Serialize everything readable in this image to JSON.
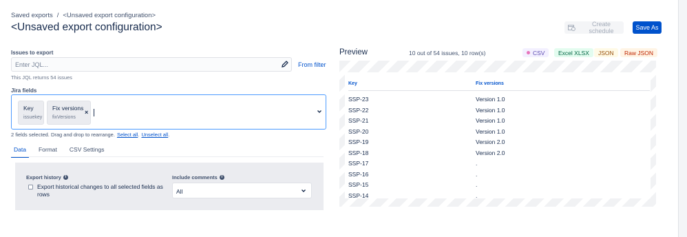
{
  "breadcrumb": {
    "parent": "Saved exports",
    "separator": "/",
    "current": "<Unsaved export configuration>"
  },
  "page_title": "<Unsaved export configuration>",
  "actions": {
    "create_schedule": "Create schedule",
    "save_as": "Save As"
  },
  "issues": {
    "label": "Issues to export",
    "placeholder": "Enter JQL...",
    "from_filter": "From filter",
    "helper": "This JQL returns 54 issues"
  },
  "fields": {
    "label": "Jira fields",
    "chips": [
      {
        "name": "Key",
        "id": "issuekey"
      },
      {
        "name": "Fix versions",
        "id": "fixVersions"
      }
    ],
    "remove_symbol": "×",
    "info": "2 fields selected. Drag and drop to rearrange.",
    "select_all": "Select all",
    "dot": ".",
    "unselect_all": "Unselect all",
    "end": "."
  },
  "tabs": [
    {
      "label": "Data",
      "active": true
    },
    {
      "label": "Format",
      "active": false
    },
    {
      "label": "CSV Settings",
      "active": false
    }
  ],
  "data_panel": {
    "export_history_title": "Export history",
    "export_history_checkbox": "Export historical changes to all selected fields as rows",
    "include_comments_title": "Include comments",
    "include_comments_value": "All",
    "info_glyph": "i"
  },
  "preview": {
    "title": "Preview",
    "count": "10 out of 54 issues, 10 row(s)",
    "formats": [
      "CSV",
      "Excel XLSX",
      "JSON",
      "Raw JSON"
    ],
    "columns": [
      "Key",
      "Fix versions"
    ],
    "rows": [
      [
        "SSP-23",
        "Version 1.0"
      ],
      [
        "SSP-22",
        "Version 1.0"
      ],
      [
        "SSP-21",
        "Version 1.0"
      ],
      [
        "SSP-20",
        "Version 1.0"
      ],
      [
        "SSP-19",
        "Version 2.0"
      ],
      [
        "SSP-18",
        "Version 2.0"
      ],
      [
        "SSP-17",
        "."
      ],
      [
        "SSP-16",
        "."
      ],
      [
        "SSP-15",
        "."
      ],
      [
        "SSP-14",
        "."
      ]
    ]
  },
  "colors": {
    "primary": "#0052cc",
    "focus": "#4c9aff",
    "text": "#172b4d"
  }
}
